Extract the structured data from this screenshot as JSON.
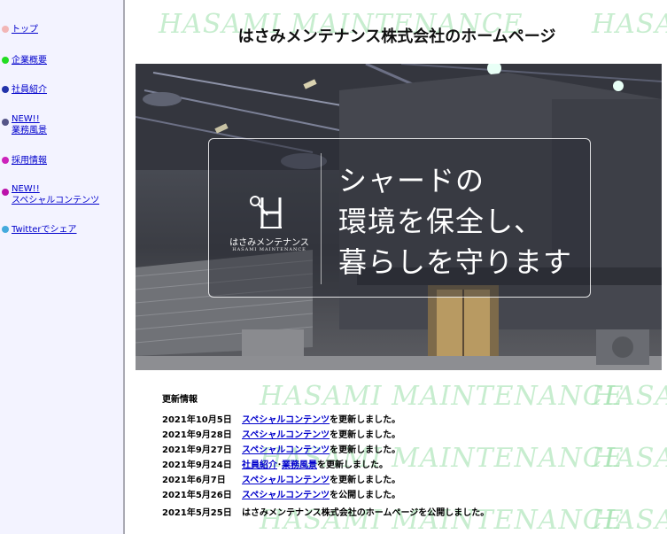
{
  "sidebar": {
    "items": [
      {
        "line1": "トップ",
        "line2": "",
        "color": "#f2b6b6"
      },
      {
        "line1": "企業概要",
        "line2": "",
        "color": "#22dd22"
      },
      {
        "line1": "社員紹介",
        "line2": "",
        "color": "#2233aa"
      },
      {
        "line1": "NEW!!",
        "line2": "業務風景",
        "color": "#555588"
      },
      {
        "line1": "採用情報",
        "line2": "",
        "color": "#cc22bb"
      },
      {
        "line1": "NEW!!",
        "line2": "スペシャルコンテンツ",
        "color": "#bb11aa"
      },
      {
        "line1": "Twitterでシェア",
        "line2": "",
        "color": "#44aadd"
      }
    ]
  },
  "watermark": "HASAMI MAINTENANCE",
  "page_title": "はさみメンテナンス株式会社のホームページ",
  "hero": {
    "logo_name": "はさみメンテナンス",
    "logo_romaji": "HASAMI MAINTENANCE",
    "lines": [
      "シャードの",
      "環境を保全し、",
      "暮らしを守ります"
    ]
  },
  "news": {
    "heading": "更新情報",
    "items": [
      {
        "date": "2021年10月5日",
        "link1": "スペシャルコンテンツ",
        "sep": "",
        "link2": "",
        "text": "を更新しました。"
      },
      {
        "date": "2021年9月28日",
        "link1": "スペシャルコンテンツ",
        "sep": "",
        "link2": "",
        "text": "を更新しました。"
      },
      {
        "date": "2021年9月27日",
        "link1": "スペシャルコンテンツ",
        "sep": "",
        "link2": "",
        "text": "を更新しました。"
      },
      {
        "date": "2021年9月24日",
        "link1": "社員紹介",
        "sep": "･",
        "link2": "業務風景",
        "text": "を更新しました。"
      },
      {
        "date": "2021年6月7日",
        "link1": "スペシャルコンテンツ",
        "sep": "",
        "link2": "",
        "text": "を更新しました。"
      },
      {
        "date": "2021年5月26日",
        "link1": "スペシャルコンテンツ",
        "sep": "",
        "link2": "",
        "text": "を公開しました。"
      },
      {
        "date": "2021年5月25日",
        "link1": "",
        "sep": "",
        "link2": "",
        "text": "はさみメンテナンス株式会社のホームページを公開しました。"
      }
    ]
  }
}
